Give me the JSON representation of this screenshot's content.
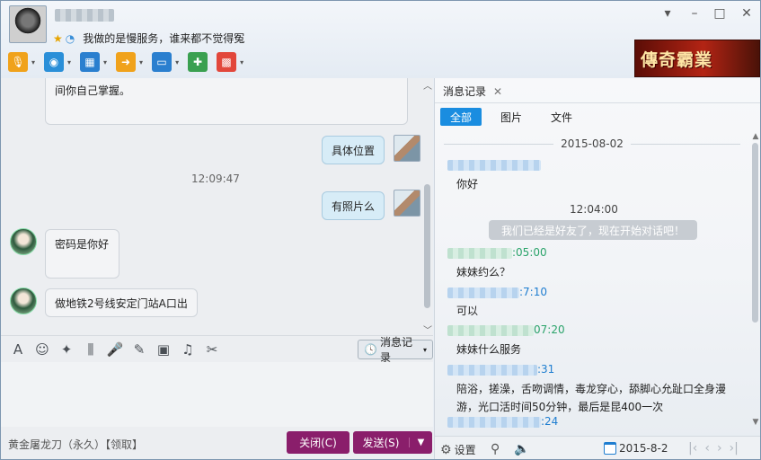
{
  "header": {
    "signature": "我做的是慢服务，谁来都不觉得冤",
    "window_controls": {
      "menu": "▾",
      "minimize": "–",
      "maximize": "□",
      "close": "✕"
    },
    "toolbar": [
      {
        "name": "voice-call-icon",
        "glyph": "🎙",
        "color": "#f0a21b"
      },
      {
        "name": "video-call-icon",
        "glyph": "◉",
        "color": "#2a8fd8"
      },
      {
        "name": "remote-desktop-icon",
        "glyph": "▦",
        "color": "#2a7fcf"
      },
      {
        "name": "send-file-icon",
        "glyph": "➜",
        "color": "#f0a21b"
      },
      {
        "name": "screen-share-icon",
        "glyph": "▭",
        "color": "#2a7fcf"
      },
      {
        "name": "new-group-chat-icon",
        "glyph": "✚",
        "color": "#3aa050"
      },
      {
        "name": "apps-grid-icon",
        "glyph": "▩",
        "color": "#e2473b"
      }
    ],
    "ad_text": "傳奇霸業"
  },
  "chat": {
    "messages": [
      {
        "side": "left",
        "text": "间你自己掌握。"
      },
      {
        "side": "right",
        "text": "具体位置"
      },
      {
        "side": "time",
        "text": "12:09:47"
      },
      {
        "side": "right",
        "text": "有照片么"
      },
      {
        "side": "left",
        "text": "密码是你好"
      },
      {
        "side": "left",
        "text": "做地铁2号线安定门站A口出"
      }
    ],
    "history_button": "消息记录"
  },
  "edit_toolbar": [
    {
      "name": "font-icon",
      "glyph": "A"
    },
    {
      "name": "emoji-icon",
      "glyph": "☺"
    },
    {
      "name": "magic-wand-icon",
      "glyph": "✦"
    },
    {
      "name": "shake-icon",
      "glyph": "⫼"
    },
    {
      "name": "voice-message-icon",
      "glyph": "🎤"
    },
    {
      "name": "edit-icon",
      "glyph": "✎"
    },
    {
      "name": "image-icon",
      "glyph": "▣"
    },
    {
      "name": "music-icon",
      "glyph": "♫"
    },
    {
      "name": "screenshot-scissors-icon",
      "glyph": "✂"
    }
  ],
  "footer": {
    "promo": "黄金屠龙刀（永久）",
    "claim": "【领取】",
    "close_button": "关闭(C)",
    "send_button": "发送(S)"
  },
  "history": {
    "tab_label": "消息记录",
    "filters": [
      "全部",
      "图片",
      "文件"
    ],
    "date": "2015-08-02",
    "entries": [
      {
        "time_suffix": "",
        "color": "blue",
        "message": "你好"
      },
      {
        "time_suffix": ":05:00",
        "color": "green",
        "message": "妹妹约么？"
      },
      {
        "time_suffix": ":7:10",
        "color": "blue",
        "message": "可以"
      },
      {
        "time_suffix": "07:20",
        "color": "green",
        "message": "妹妹什么服务"
      },
      {
        "time_suffix": ":31",
        "color": "blue",
        "message": "陪浴，搓澡，舌吻调情，毒龙穿心，舔脚心允趾口全身漫游，光口活时间50分钟，最后是昆400一次"
      },
      {
        "time_suffix": ":24",
        "color": "blue",
        "message": ""
      }
    ],
    "center_time": "12:04:00",
    "system_notice": "我们已经是好友了，现在开始对话吧！",
    "footer": {
      "settings": "设置",
      "date": "2015-8-2"
    }
  }
}
